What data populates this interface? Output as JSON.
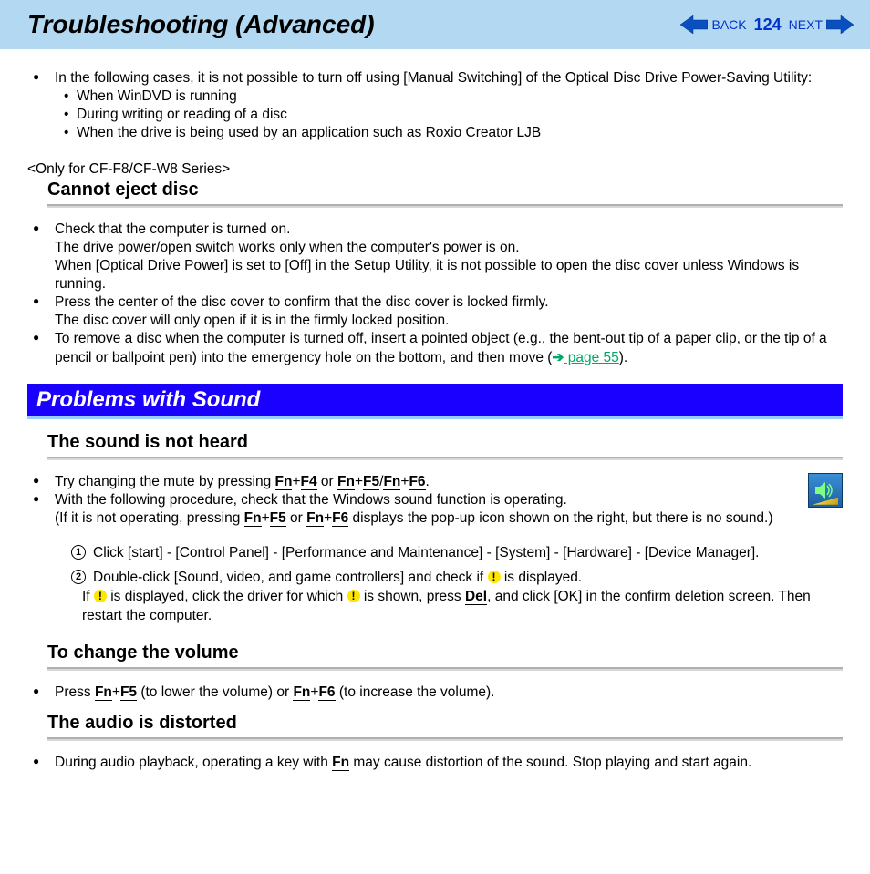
{
  "header": {
    "title": "Troubleshooting (Advanced)",
    "back": "BACK",
    "page": "124",
    "next": "NEXT"
  },
  "intro": {
    "main": "In the following cases, it is not possible to turn off using [Manual Switching] of the Optical Disc Drive Power-Saving Utility:",
    "sub1": "When WinDVD is running",
    "sub2": "During writing or reading of a disc",
    "sub3": "When the drive is being used by an application such as Roxio Creator LJB"
  },
  "only_note": "<Only for CF-F8/CF-W8 Series>",
  "cannot_eject": {
    "heading": "Cannot eject disc",
    "b1a": "Check that the computer is turned on.",
    "b1b": "The drive power/open switch works only when the computer's power is on.",
    "b1c": "When [Optical Drive Power] is set to [Off] in the Setup Utility, it is not possible to open the disc cover unless Windows is running.",
    "b2a": "Press the center of the disc cover to confirm that the disc cover is locked firmly.",
    "b2b": "The disc cover will only open if it is in the firmly locked position.",
    "b3a": "To remove a disc when the computer is turned off, insert a pointed object (e.g., the bent-out tip of a paper clip, or the tip of a pencil or ballpoint pen) into the emergency hole on the bottom, and then move (",
    "b3_link": " page 55",
    "b3b": ")."
  },
  "banner_sound": "Problems with Sound",
  "not_heard": {
    "heading": "The sound is not heard",
    "b1_pre": "Try changing the mute by pressing ",
    "or": " or ",
    "slash": "/",
    "b1_post": ".",
    "b2a": "With the following procedure, check that the Windows sound function is operating.",
    "b2b_pre": "(If it is not operating, pressing ",
    "b2b_mid": " or ",
    "b2b_post": " displays the pop-up icon shown on the right, but there is no sound.)",
    "p1": "Click [start] - [Control Panel] - [Performance and Maintenance] - [System] - [Hardware] - [Device Manager].",
    "p2_pre": "Double-click [Sound, video, and game controllers] and check if ",
    "p2_post": " is displayed.",
    "p2c_pre": "If ",
    "p2c_mid1": " is displayed, click the driver for which ",
    "p2c_mid2": " is shown, press ",
    "p2c_post": ", and click [OK] in the confirm deletion screen. Then restart the computer."
  },
  "change_vol": {
    "heading": "To change the volume",
    "b_pre": "Press ",
    "b_mid1": " (to lower the volume) or ",
    "b_mid2": " (to increase the volume)."
  },
  "distorted": {
    "heading": "The audio is distorted",
    "b_pre": "During audio playback, operating a key with ",
    "b_post": " may cause distortion of the sound. Stop playing and start again."
  },
  "keys": {
    "fn": "Fn",
    "f4": "F4",
    "f5": "F5",
    "f6": "F6",
    "del": "Del"
  }
}
